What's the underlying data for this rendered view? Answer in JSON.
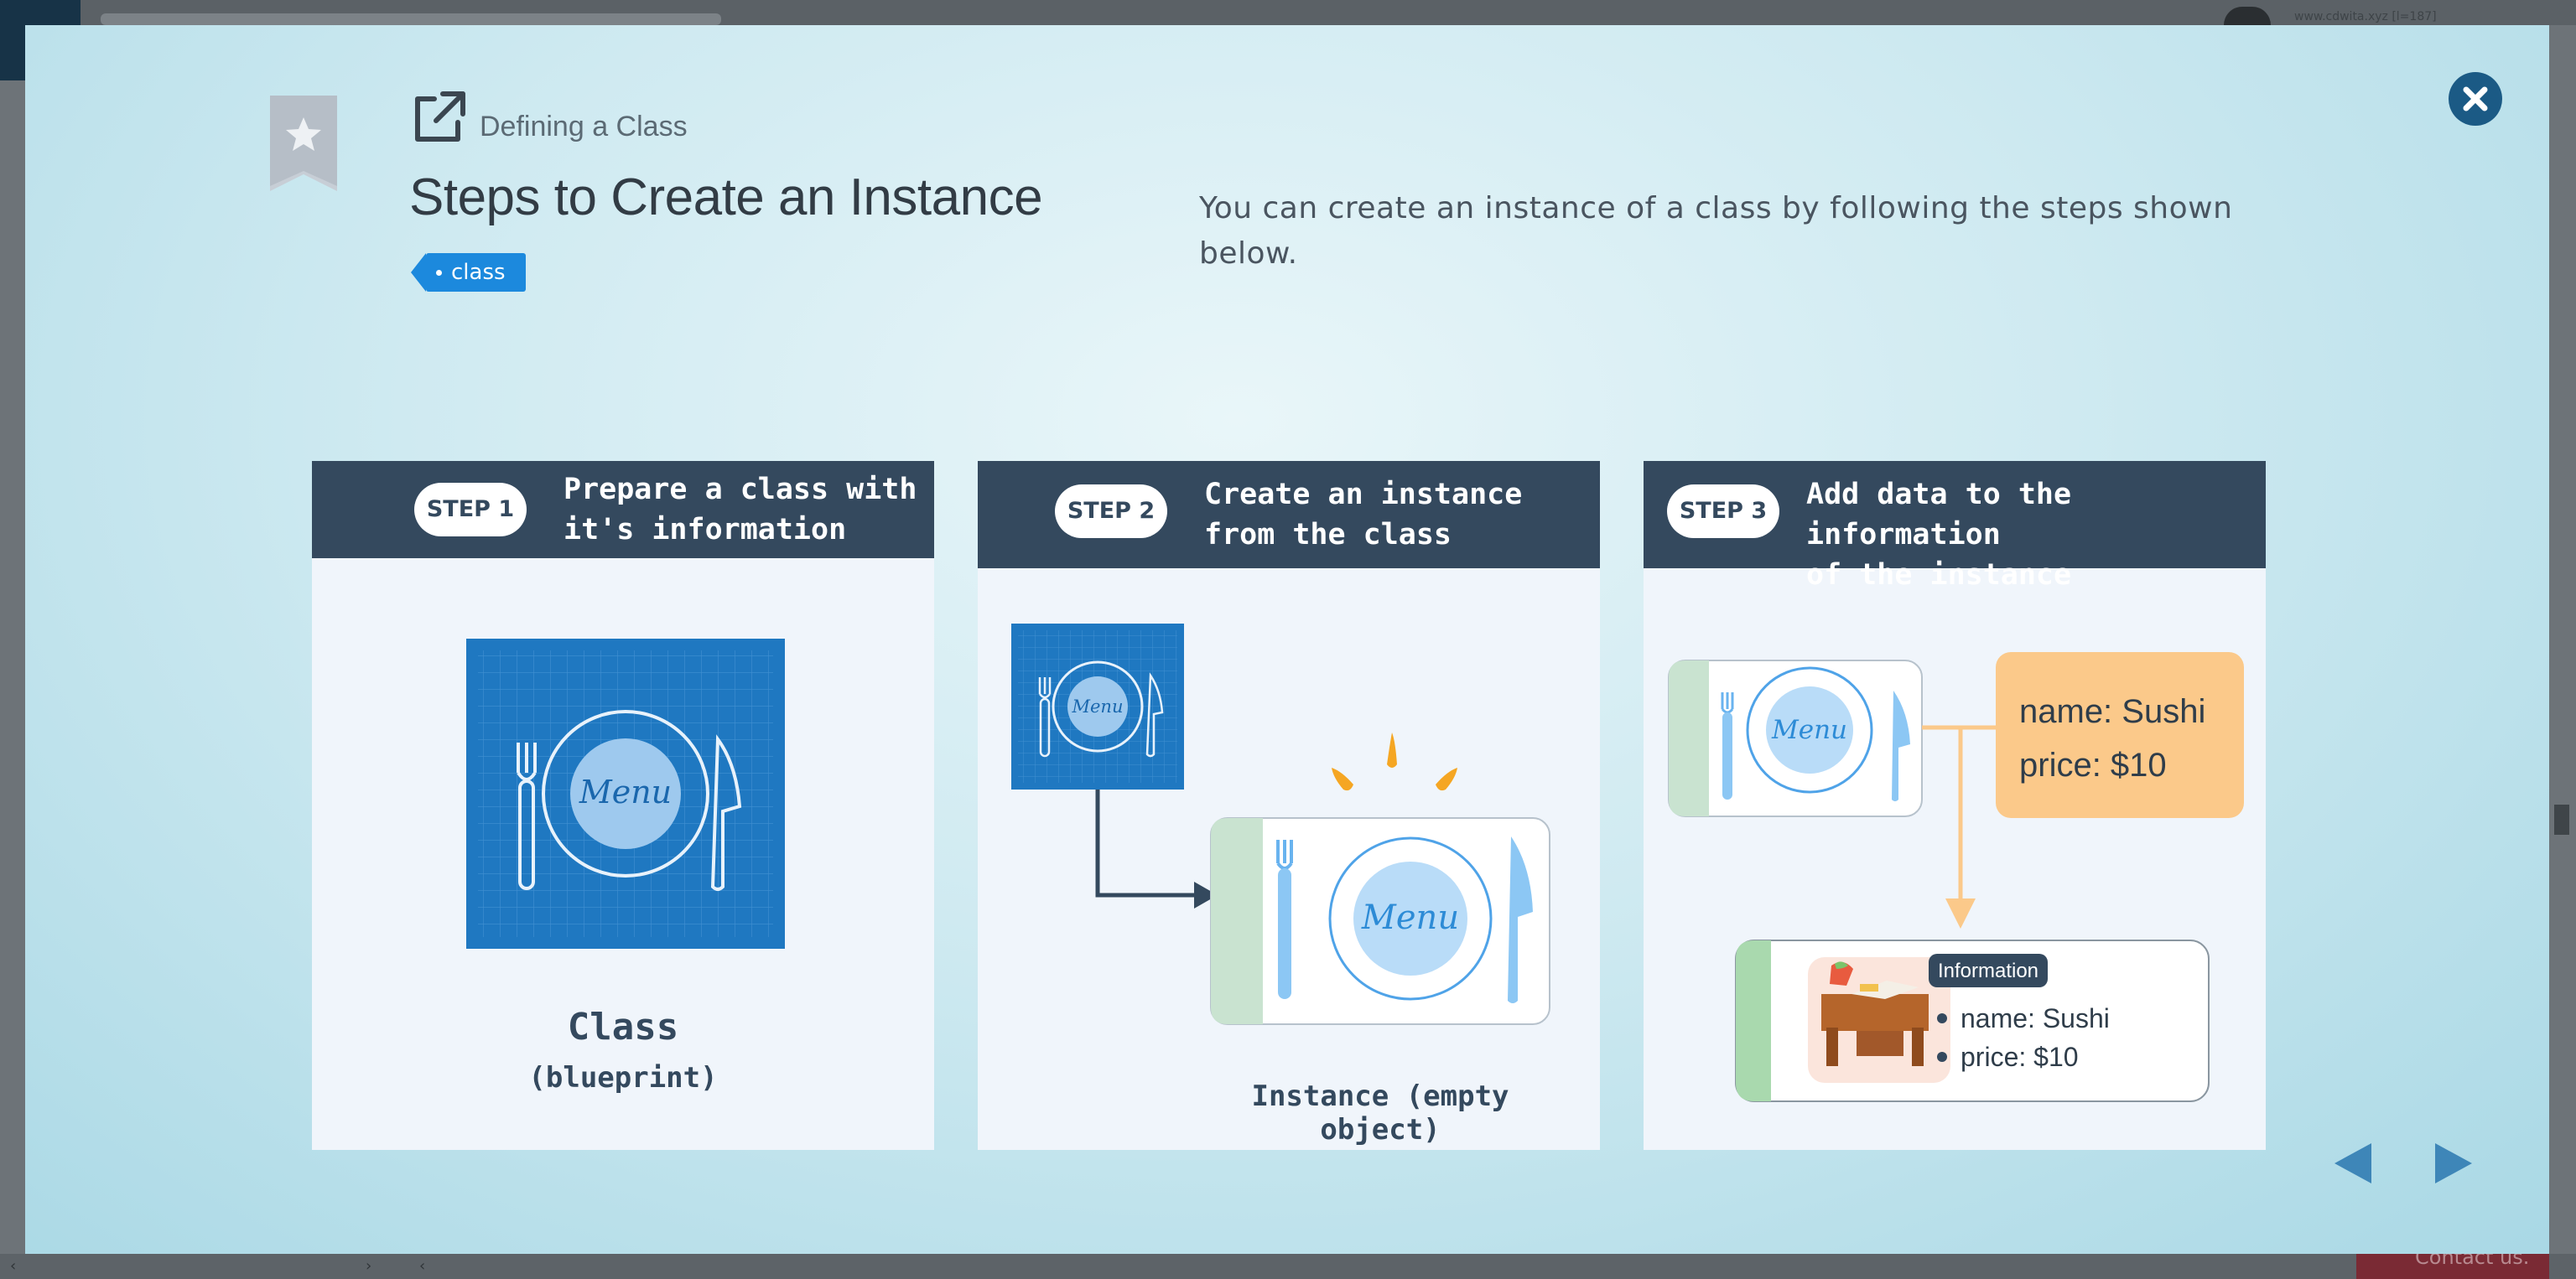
{
  "background": {
    "url_text": "www.cdwita.xyz [l=187]",
    "contact_label": "Contact us."
  },
  "header": {
    "eyebrow": "Defining a Class",
    "title": "Steps to Create an Instance",
    "tag_label": "class",
    "intro_text": "You can create an instance of a class by following the steps shown below."
  },
  "steps": [
    {
      "badge": "STEP 1",
      "heading_line1": "Prepare a class with",
      "heading_line2": "it's information",
      "caption_main": "Class",
      "caption_sub": "(blueprint)",
      "plate_label": "Menu"
    },
    {
      "badge": "STEP 2",
      "heading_line1": "Create an instance",
      "heading_line2": "from the class",
      "caption_main": "Instance (empty object)",
      "plate_label": "Menu"
    },
    {
      "badge": "STEP 3",
      "heading_line1": "Add data to the information",
      "heading_line2": "of the instance",
      "plate_label": "Menu",
      "data_line1": "name: Sushi",
      "data_line2": "price: $10",
      "info_badge": "Information",
      "info_item1": "name: Sushi",
      "info_item2": "price: $10"
    }
  ],
  "colors": {
    "header_bar": "#34495e",
    "accent_blue": "#1c89dd",
    "blueprint": "#1f78c1",
    "data_box": "#fbc98a",
    "close_button": "#1b5a85",
    "nav_arrows": "#3e86b8"
  },
  "icons": {
    "bookmark": "bookmark-star-icon",
    "external": "external-link-icon",
    "close": "close-icon",
    "prev": "arrow-left-icon",
    "next": "arrow-right-icon"
  }
}
